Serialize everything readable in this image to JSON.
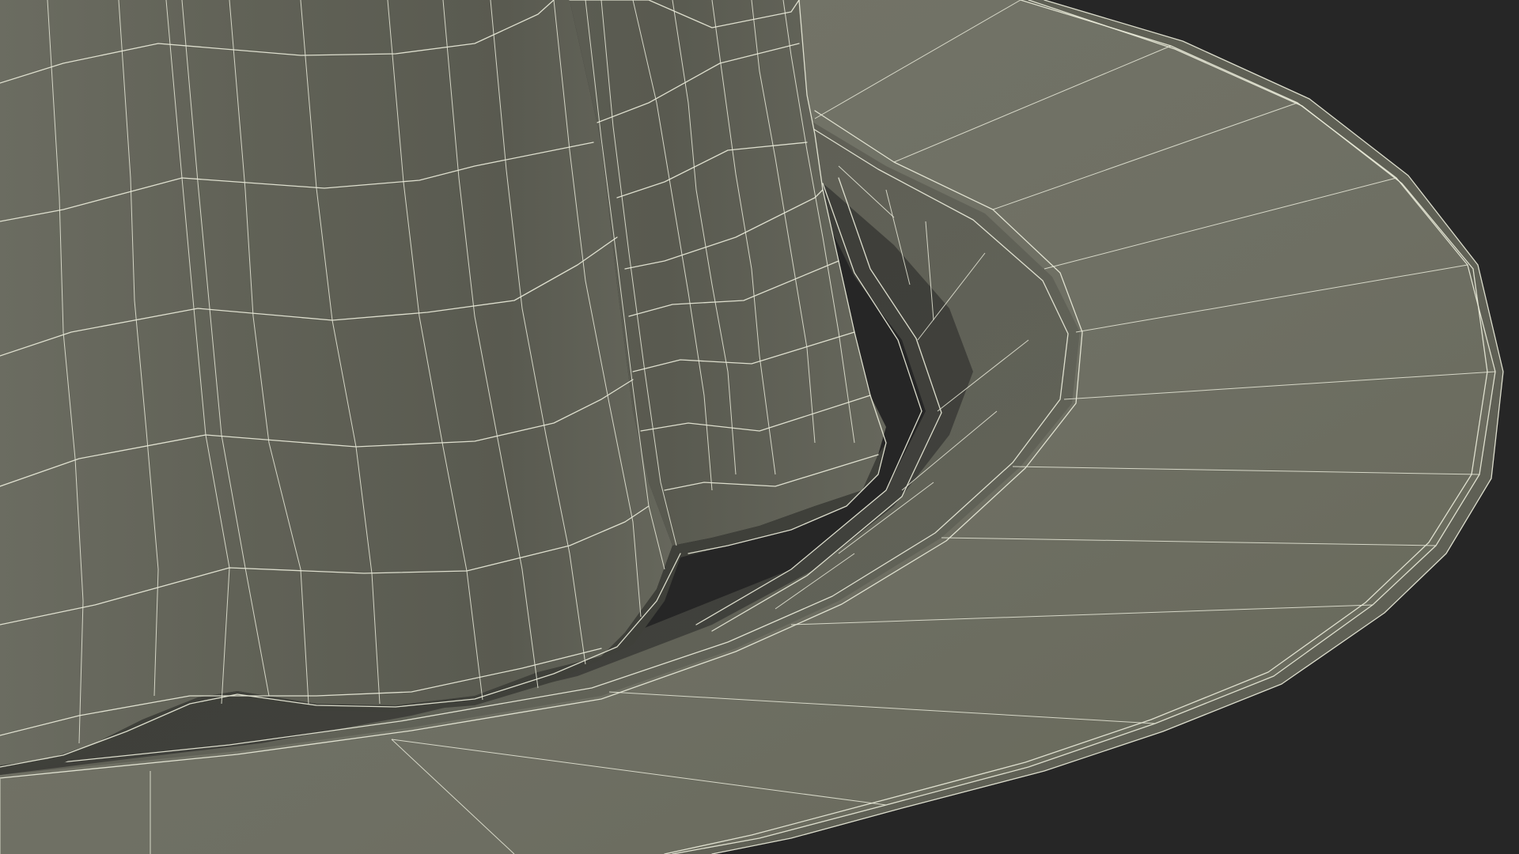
{
  "scene": {
    "description_visible_text": "",
    "colors": {
      "background": "#262626",
      "mesh_surface_light": "#75766a",
      "mesh_surface_mid": "#66675b",
      "mesh_surface_dark": "#4d4d45",
      "wireframe": "#e9ead9"
    },
    "objects": [
      {
        "name": "cup-wireframe-mesh"
      },
      {
        "name": "saucer-wireframe-mesh"
      }
    ]
  }
}
